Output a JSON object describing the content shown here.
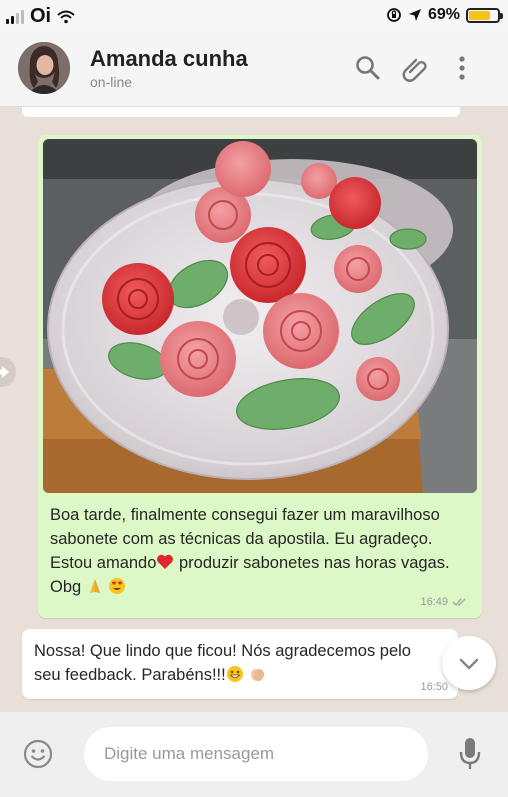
{
  "status_bar": {
    "carrier": "Oi",
    "battery_percent": "69%",
    "battery_level": 0.69,
    "icons": [
      "signal-icon",
      "wifi-icon",
      "orientation-lock-icon",
      "location-icon",
      "battery-icon"
    ]
  },
  "header": {
    "contact_name": "Amanda cunha",
    "status": "on-line",
    "icons": [
      "search-icon",
      "attach-icon",
      "more-icon"
    ]
  },
  "chat": {
    "outgoing": {
      "text_parts": [
        "Boa tarde, finalmente consegui fazer um maravilhoso sabonete com as técnicas da apostila. Eu agradeço. Estou amando",
        " produzir sabonetes nas horas vagas. Obg "
      ],
      "time": "16:49",
      "emojis": [
        "heart-emoji",
        "praying-hands-emoji",
        "heart-eyes-emoji"
      ]
    },
    "incoming": {
      "text": "Nossa! Que lindo que ficou! Nós agradecemos pelo seu feedback. Parabéns!!!",
      "time": "16:50",
      "emojis": [
        "grinning-emoji",
        "clapping-hands-emoji"
      ]
    }
  },
  "composer": {
    "placeholder": "Digite uma mensagem"
  },
  "colors": {
    "outgoing_bubble": "#dcf8c6",
    "incoming_bubble": "#ffffff",
    "chat_background": "#e8e0d8",
    "battery": "#f5c518"
  }
}
